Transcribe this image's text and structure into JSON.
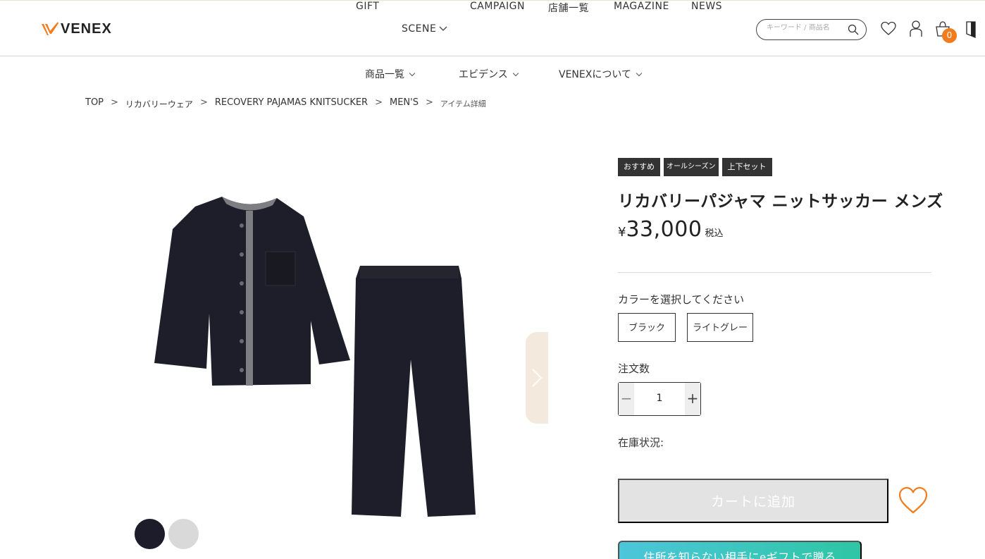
{
  "header": {
    "logo_text": "VENEX",
    "nav": [
      "GIFT",
      "SCENE",
      "CAMPAIGN",
      "店舗一覧",
      "MAGAZINE",
      "NEWS"
    ],
    "search_placeholder": "キーワード / 商品名",
    "cart_count": "0",
    "accent_color": "#f07c1e"
  },
  "subnav": [
    "商品一覧",
    "エビデンス",
    "VENEXについて"
  ],
  "breadcrumb": [
    "TOP",
    "リカバリーウェア",
    "RECOVERY PAJAMAS KNITSUCKER",
    "MEN'S",
    "アイテム詳細"
  ],
  "breadcrumb_sep": ">",
  "product": {
    "tags": [
      "おすすめ",
      "オールシーズン",
      "上下セット"
    ],
    "title": "リカバリーパジャマ ニットサッカー メンズ",
    "price_symbol": "¥",
    "price_value": "33,000",
    "price_tax": "税込",
    "color_label": "カラーを選択してください",
    "colors": [
      "ブラック",
      "ライトグレー"
    ],
    "swatch_colors": [
      "#1c1c2a",
      "#d9d9d9"
    ],
    "qty_label": "注文数",
    "qty_value": "1",
    "qty_minus": "−",
    "qty_plus": "+",
    "stock_label": "在庫状況:",
    "cart_button": "カートに追加",
    "egift_button": "住所を知らない相手にeギフトで贈る"
  }
}
